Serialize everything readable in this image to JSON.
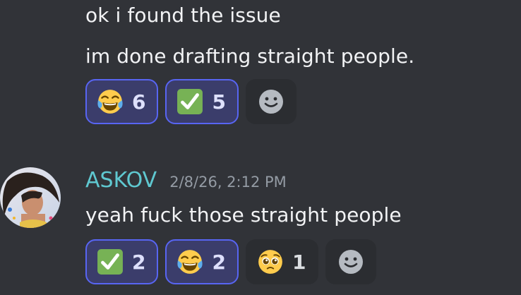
{
  "messages_top": {
    "line1": "ok i found the issue",
    "line2": "im done drafting straight people."
  },
  "reactions_top": [
    {
      "emoji": "joy-emoji",
      "count": "6",
      "active": true
    },
    {
      "emoji": "check-mark-emoji",
      "count": "5",
      "active": true
    }
  ],
  "message2": {
    "username": "ASKOV",
    "timestamp": "2/8/26, 2:12 PM",
    "text": "yeah fuck those straight people"
  },
  "reactions_bottom": [
    {
      "emoji": "check-mark-emoji",
      "count": "2",
      "active": true
    },
    {
      "emoji": "joy-emoji",
      "count": "2",
      "active": true
    },
    {
      "emoji": "pleading-face-emoji",
      "count": "1",
      "active": false
    }
  ],
  "colors": {
    "background": "#313338",
    "active_reaction_bg": "#3b3d6b",
    "active_reaction_border": "#5865f2",
    "username": "#5fc8d0",
    "timestamp": "#949ba4"
  },
  "icons": {
    "add_reaction": "smiley-add-reaction-icon"
  }
}
